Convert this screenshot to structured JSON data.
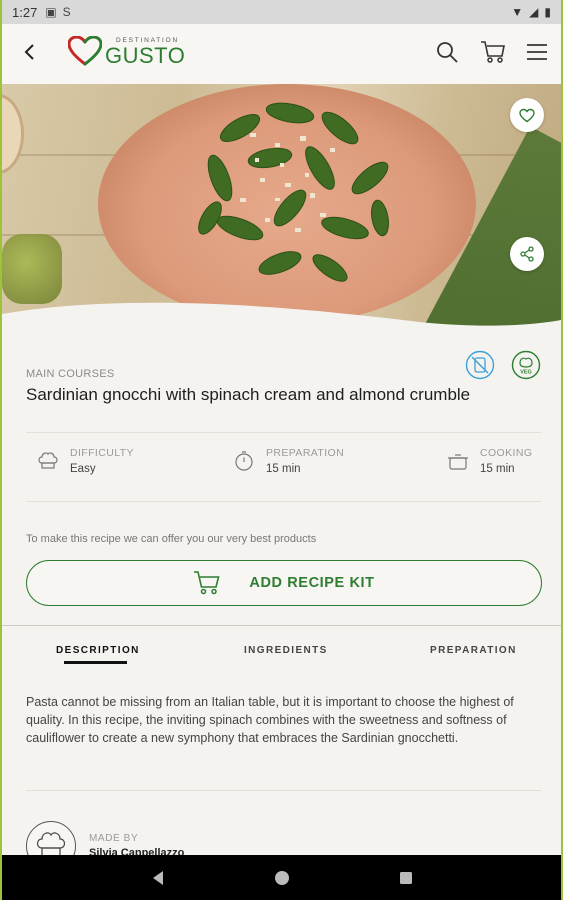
{
  "status_bar": {
    "time": "1:27"
  },
  "header": {
    "logo_top": "DESTINATION",
    "logo_main": "GUSTO"
  },
  "recipe": {
    "category": "MAIN COURSES",
    "title": "Sardinian gnocchi with spinach cream and almond crumble",
    "diet_badges": [
      "gluten-free-icon",
      "vegetarian-icon"
    ],
    "veg_badge_text": "VEG",
    "info": [
      {
        "label": "DIFFICULTY",
        "value": "Easy",
        "icon": "chef-hat-icon"
      },
      {
        "label": "PREPARATION",
        "value": "15 min",
        "icon": "timer-icon"
      },
      {
        "label": "COOKING",
        "value": "15 min",
        "icon": "pot-icon"
      }
    ],
    "offer_text": "To make this recipe we can offer you our very best products",
    "kit_button": "ADD RECIPE KIT"
  },
  "tabs": [
    {
      "label": "DESCRIPTION",
      "active": true
    },
    {
      "label": "INGREDIENTS",
      "active": false
    },
    {
      "label": "PREPARATION",
      "active": false
    }
  ],
  "description": "Pasta cannot be missing from an Italian table, but it is important to choose the highest of quality. In this recipe, the inviting spinach combines with the sweetness and softness of cauliflower to create a new symphony that embraces the Sardinian gnocchetti.",
  "author": {
    "label": "MADE BY",
    "name": "Silvia Cappellazzo"
  },
  "colors": {
    "brand_green": "#2e7d32",
    "accent_blue": "#3aa0d8",
    "background": "#f5f3ef"
  }
}
